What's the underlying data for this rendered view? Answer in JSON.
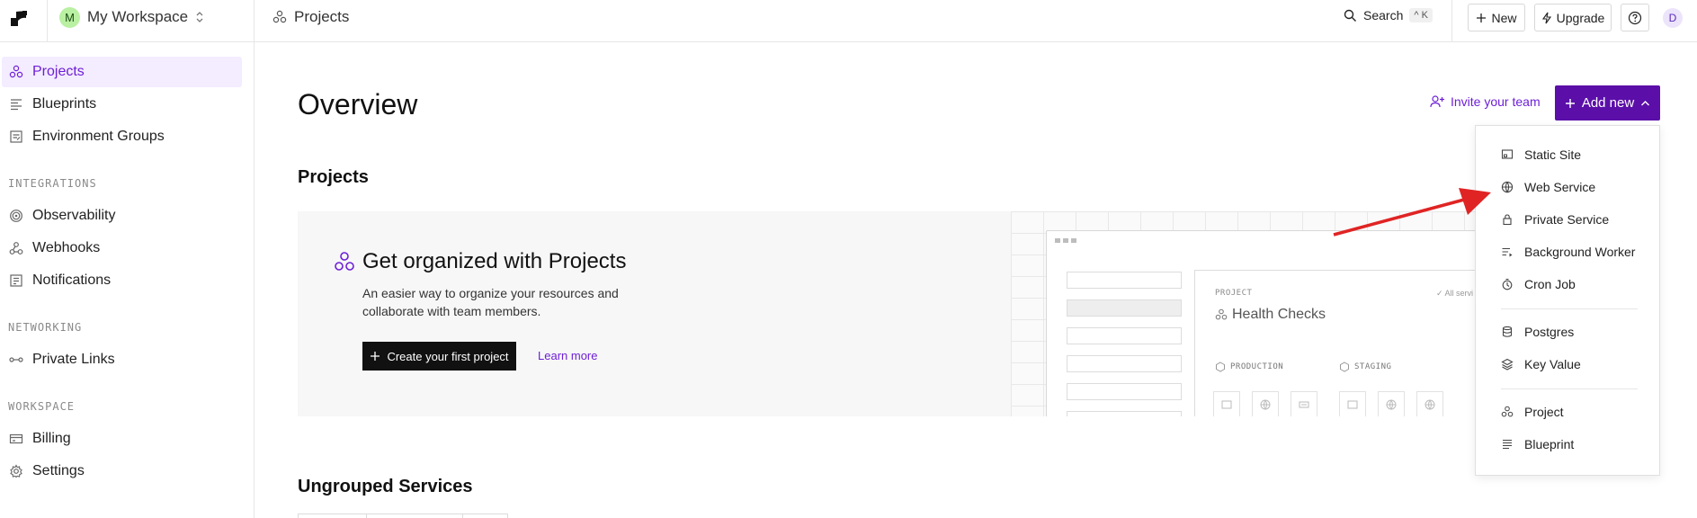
{
  "header": {
    "workspace_initial": "M",
    "workspace_name": "My Workspace",
    "breadcrumb": "Projects",
    "search_label": "Search",
    "search_shortcut": "^ K",
    "new_label": "New",
    "upgrade_label": "Upgrade",
    "user_initial": "D"
  },
  "sidebar": {
    "items_top": [
      "Projects",
      "Blueprints",
      "Environment Groups"
    ],
    "integrations_label": "INTEGRATIONS",
    "integrations": [
      "Observability",
      "Webhooks",
      "Notifications"
    ],
    "networking_label": "NETWORKING",
    "networking": [
      "Private Links"
    ],
    "workspace_label": "WORKSPACE",
    "workspace": [
      "Billing",
      "Settings"
    ]
  },
  "main": {
    "title": "Overview",
    "invite_label": "Invite your team",
    "add_new_label": "Add new",
    "projects_heading": "Projects",
    "ungrouped_heading": "Ungrouped Services",
    "banner": {
      "title": "Get organized with Projects",
      "description": "An easier way to organize your resources and collaborate with team members.",
      "create_label": "Create your first project",
      "learn_label": "Learn more",
      "mock": {
        "project_label": "PROJECT",
        "project_name": "Health Checks",
        "all_services": "✓ All servi",
        "env_production": "PRODUCTION",
        "env_staging": "STAGING"
      }
    }
  },
  "dropdown": {
    "items": [
      "Static Site",
      "Web Service",
      "Private Service",
      "Background Worker",
      "Cron Job",
      "Postgres",
      "Key Value",
      "Project",
      "Blueprint"
    ]
  },
  "colors": {
    "accent": "#6d1fd6",
    "add_new_bg": "#5b0fa8",
    "active_nav_bg": "#f4ecff",
    "arrow": "#e02424"
  }
}
